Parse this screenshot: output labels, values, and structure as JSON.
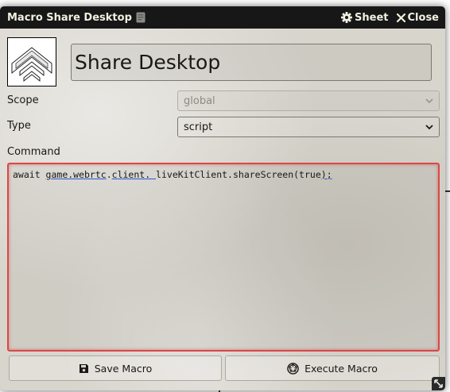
{
  "window": {
    "title": "Macro Share Desktop",
    "sheet_label": "Sheet",
    "close_label": "Close"
  },
  "macro": {
    "name": "Share Desktop",
    "scope_label": "Scope",
    "scope_value": "global",
    "type_label": "Type",
    "type_value": "script",
    "command_label": "Command",
    "command": {
      "t1": "await ",
      "t2": "game.webrtc",
      "t3": ".",
      "t4": "client. ",
      "t5": "liveKitClient.shareScreen(true",
      "t6": ");"
    }
  },
  "buttons": {
    "save": "Save Macro",
    "execute": "Execute Macro"
  },
  "colors": {
    "titlebar": "#171717",
    "sheet_bg": "#d8d5cd",
    "invalid_border": "#d64a48",
    "link_underline": "#2a58d6"
  },
  "icons": [
    "book-icon",
    "gear-icon",
    "close-icon",
    "chevron-up-icon",
    "chevron-down-icon",
    "save-icon",
    "dice-icon",
    "resize-icon"
  ]
}
